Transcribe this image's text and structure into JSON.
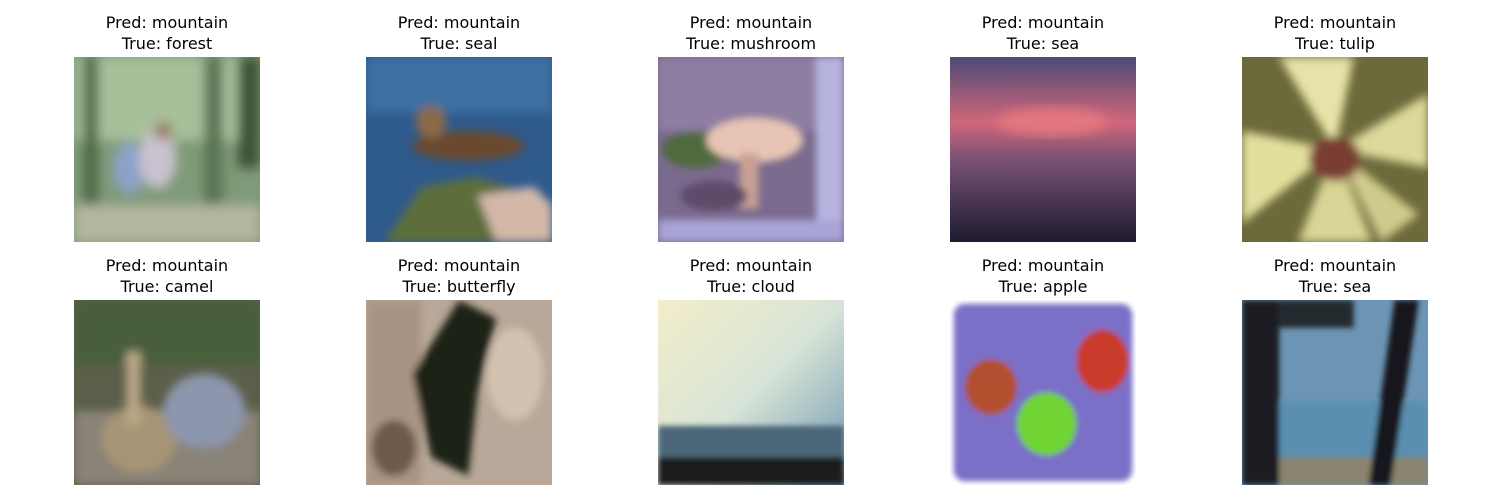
{
  "grid": {
    "items": [
      {
        "pred_label": "Pred: mountain",
        "true_label": "True: forest"
      },
      {
        "pred_label": "Pred: mountain",
        "true_label": "True: seal"
      },
      {
        "pred_label": "Pred: mountain",
        "true_label": "True: mushroom"
      },
      {
        "pred_label": "Pred: mountain",
        "true_label": "True: sea"
      },
      {
        "pred_label": "Pred: mountain",
        "true_label": "True: tulip"
      },
      {
        "pred_label": "Pred: mountain",
        "true_label": "True: camel"
      },
      {
        "pred_label": "Pred: mountain",
        "true_label": "True: butterfly"
      },
      {
        "pred_label": "Pred: mountain",
        "true_label": "True: cloud"
      },
      {
        "pred_label": "Pred: mountain",
        "true_label": "True: apple"
      },
      {
        "pred_label": "Pred: mountain",
        "true_label": "True: sea"
      }
    ]
  }
}
